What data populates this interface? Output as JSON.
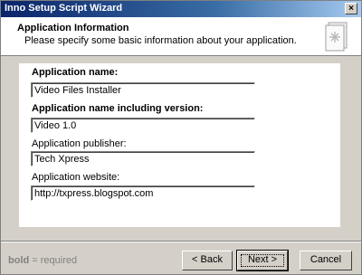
{
  "window": {
    "title": "Inno Setup Script Wizard",
    "close_glyph": "×"
  },
  "header": {
    "title": "Application Information",
    "subtitle": "Please specify some basic information about your application."
  },
  "form": {
    "app_name_label": "Application name:",
    "app_name_value": "Video Files Installer",
    "app_version_label": "Application name including version:",
    "app_version_value": "Video 1.0",
    "publisher_label": "Application publisher:",
    "publisher_value": "Tech Xpress",
    "website_label": "Application website:",
    "website_value": "http://txpress.blogspot.com"
  },
  "footer": {
    "legend_bold": "bold",
    "legend_rest": " = required",
    "back_label": "< Back",
    "next_label": "Next >",
    "cancel_label": "Cancel"
  }
}
